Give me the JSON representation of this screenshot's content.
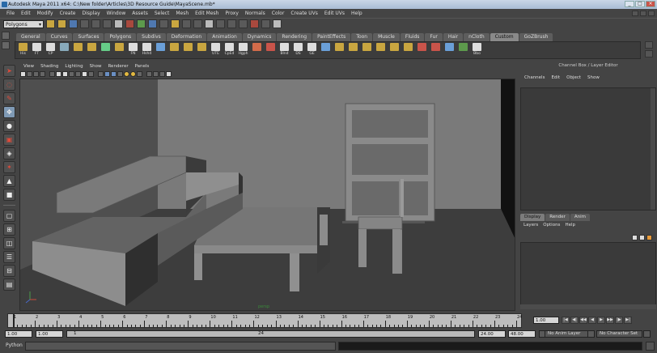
{
  "window": {
    "title": "Autodesk Maya 2011 x64: C:\\New folder\\Articles\\3D Resource Guide\\MayaScene.mb*",
    "buttons": [
      "_",
      "□",
      "×"
    ]
  },
  "menubar": {
    "items": [
      "File",
      "Edit",
      "Modify",
      "Create",
      "Display",
      "Window",
      "Assets",
      "Select",
      "Mesh",
      "Edit Mesh",
      "Proxy",
      "Normals",
      "Color",
      "Create UVs",
      "Edit UVs",
      "Help"
    ]
  },
  "statusline": {
    "mode": "Polygons"
  },
  "shelf": {
    "tabs": [
      "General",
      "Curves",
      "Surfaces",
      "Polygons",
      "Subdivs",
      "Deformation",
      "Animation",
      "Dynamics",
      "Rendering",
      "PaintEffects",
      "Toon",
      "Muscle",
      "Fluids",
      "Fur",
      "Hair",
      "nCloth",
      "Custom",
      "GoZBrush"
    ],
    "active_tab": "Custom",
    "tools": [
      {
        "label": "His",
        "icon": "history-icon",
        "color": "#c9a640"
      },
      {
        "label": "FT",
        "icon": "freeze-icon",
        "color": "#ddd"
      },
      {
        "label": "CP",
        "icon": "center-pivot-icon",
        "color": "#ddd"
      },
      {
        "label": "",
        "icon": "grid-icon",
        "color": "#8ab"
      },
      {
        "label": "",
        "icon": "move-icon",
        "color": "#c9a640"
      },
      {
        "label": "",
        "icon": "select-icon",
        "color": "#c9a640"
      },
      {
        "label": "",
        "icon": "edge-icon",
        "color": "#6c8"
      },
      {
        "label": "",
        "icon": "face-icon",
        "color": "#c9a640"
      },
      {
        "label": "FN",
        "icon": "face-normal-icon",
        "color": "#ddd"
      },
      {
        "label": "Hshd",
        "icon": "hypershade-icon",
        "color": "#ddd"
      },
      {
        "label": "",
        "icon": "mesh-icon",
        "color": "#6a9fd8"
      },
      {
        "label": "",
        "icon": "snap-icon",
        "color": "#c9a640"
      },
      {
        "label": "",
        "icon": "vertex-icon",
        "color": "#c9a640"
      },
      {
        "label": "",
        "icon": "split-icon",
        "color": "#c9a640"
      },
      {
        "label": "UTE",
        "icon": "uv-editor-icon",
        "color": "#ddd"
      },
      {
        "label": "CpEd",
        "icon": "component-editor-icon",
        "color": "#ddd"
      },
      {
        "label": "Hgph",
        "icon": "hypergraph-icon",
        "color": "#ddd"
      },
      {
        "label": "",
        "icon": "render-icon",
        "color": "#d26b4a"
      },
      {
        "label": "",
        "icon": "paint-icon",
        "color": "#c9544a"
      },
      {
        "label": "Blnd",
        "icon": "blend-icon",
        "color": "#ddd"
      },
      {
        "label": "DS",
        "icon": "deform-icon",
        "color": "#ddd"
      },
      {
        "label": "GE",
        "icon": "graph-editor-icon",
        "color": "#ddd"
      },
      {
        "label": "",
        "icon": "curve-icon",
        "color": "#6a9fd8"
      },
      {
        "label": "",
        "icon": "extrude-icon",
        "color": "#c9a640"
      },
      {
        "label": "",
        "icon": "bevel-icon",
        "color": "#c9a640"
      },
      {
        "label": "",
        "icon": "merge-icon",
        "color": "#c9a640"
      },
      {
        "label": "",
        "icon": "bridge-icon",
        "color": "#c9a640"
      },
      {
        "label": "",
        "icon": "append-icon",
        "color": "#c9a640"
      },
      {
        "label": "",
        "icon": "fill-icon",
        "color": "#c9a640"
      },
      {
        "label": "",
        "icon": "combine-icon",
        "color": "#c9544a"
      },
      {
        "label": "",
        "icon": "separate-icon",
        "color": "#c9544a"
      },
      {
        "label": "",
        "icon": "mirror-icon",
        "color": "#6a9fd8"
      },
      {
        "label": "",
        "icon": "smooth-icon",
        "color": "#5d9a4c"
      },
      {
        "label": "Bbo",
        "icon": "bbo-icon",
        "color": "#ddd"
      }
    ]
  },
  "panel": {
    "menus": [
      "View",
      "Shading",
      "Lighting",
      "Show",
      "Renderer",
      "Panels"
    ],
    "camera": "persp"
  },
  "channelbox": {
    "title": "Channel Box / Layer Editor",
    "menus": [
      "Channels",
      "Edit",
      "Object",
      "Show"
    ]
  },
  "layereditor": {
    "tabs": [
      "Display",
      "Render",
      "Anim"
    ],
    "active_tab": "Display",
    "menus": [
      "Layers",
      "Options",
      "Help"
    ]
  },
  "timeslider": {
    "ticks": [
      "1",
      "2",
      "3",
      "4",
      "5",
      "6",
      "7",
      "8",
      "9",
      "10",
      "11",
      "12",
      "13",
      "14",
      "15",
      "16",
      "17",
      "18",
      "19",
      "20",
      "21",
      "22",
      "23",
      "24"
    ],
    "end_label": "24",
    "current": "1.00"
  },
  "rangeslider": {
    "start": "1.00",
    "playback_start": "1.00",
    "bar_start": "1",
    "bar_end": "24",
    "playback_end": "24.00",
    "end": "48.00",
    "anim_layer": "No Anim Layer",
    "character_set": "No Character Set"
  },
  "commandline": {
    "label": "Python"
  },
  "colors": {
    "ui_bg": "#444444",
    "viewport_bg": "#4f4f4f",
    "active_tab": "#898989",
    "timeline": "#bdbdbd"
  }
}
